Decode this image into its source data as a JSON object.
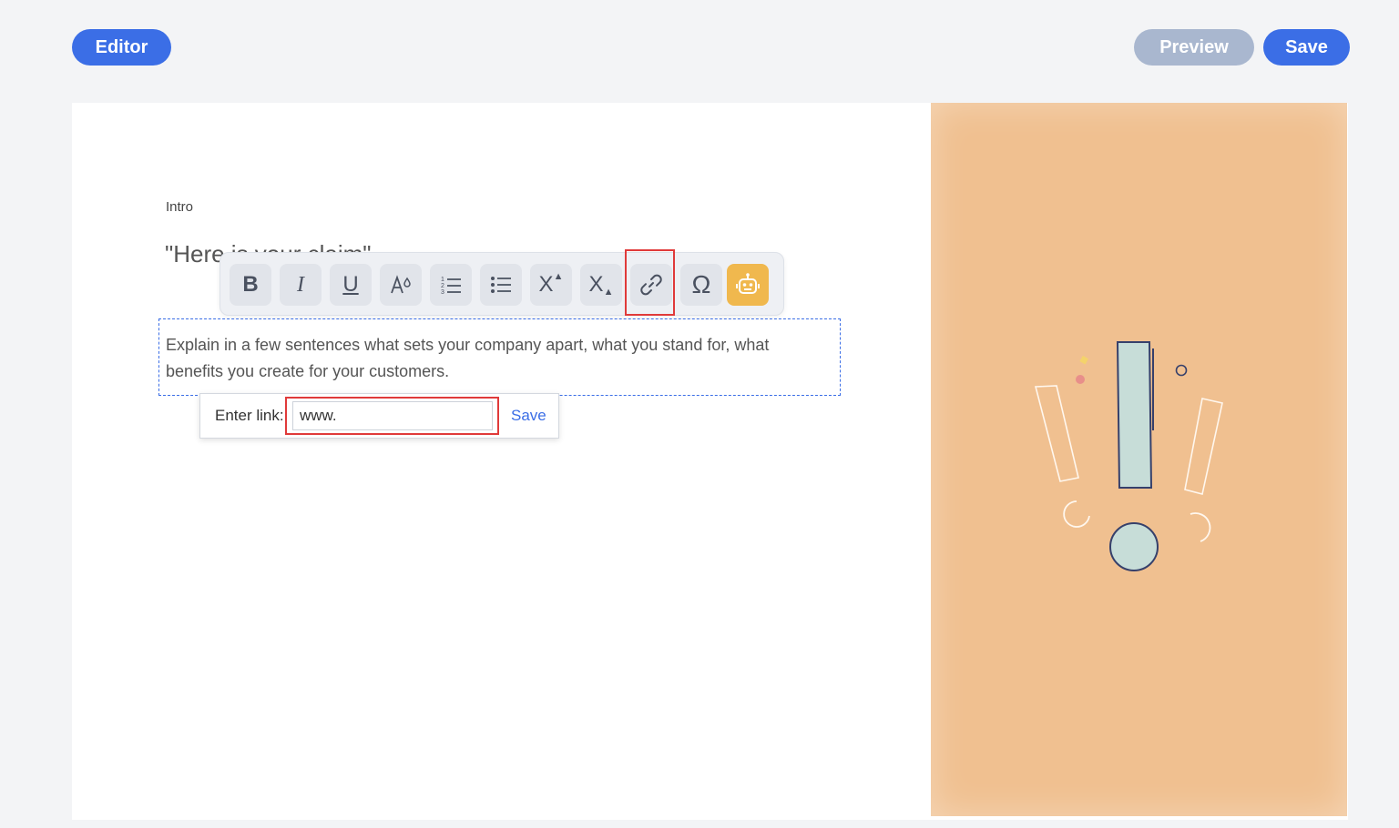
{
  "header": {
    "editor_label": "Editor",
    "preview_label": "Preview",
    "save_label": "Save"
  },
  "content": {
    "intro_label": "Intro",
    "claim_text": "\"Here is your claim\"",
    "paragraph": "Explain in a few sentences what sets your company apart, what you stand for, what benefits you create for your customers."
  },
  "toolbar": {
    "buttons": [
      "bold-icon",
      "italic-icon",
      "underline-icon",
      "font-color-icon",
      "ordered-list-icon",
      "bullet-list-icon",
      "superscript-icon",
      "subscript-icon",
      "link-icon",
      "special-character-icon",
      "ai-assistant-icon"
    ],
    "bold_glyph": "B",
    "italic_glyph": "I",
    "underline_glyph": "U",
    "superscript_glyph": "X",
    "subscript_glyph": "X",
    "omega_glyph": "Ω"
  },
  "link_popover": {
    "label": "Enter link:",
    "value": "www.",
    "save_label": "Save"
  },
  "colors": {
    "primary": "#3b6ee6",
    "preview_disabled": "#a9b7cf",
    "highlight": "#e03a3a",
    "art_background": "#f0c090",
    "ai_button": "#f0b84e"
  }
}
